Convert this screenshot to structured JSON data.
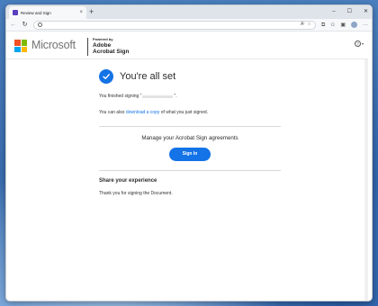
{
  "browser": {
    "tab_title": "Review and Sign",
    "new_tab_symbol": "+",
    "close_symbol": "×",
    "window_controls": [
      "–",
      "☐",
      "✕"
    ],
    "toolbar_symbols": {
      "back": "←",
      "refresh": "↻",
      "read_aloud": "A⁾",
      "favorite": "☆",
      "extensions": "⧉",
      "favorites_bar": "✩",
      "collections": "▣",
      "menu": "···"
    }
  },
  "header": {
    "brand": "Microsoft",
    "powered_by": "Powered by",
    "product_line1": "Adobe",
    "product_line2": "Acrobat Sign",
    "help_symbol": "?",
    "help_caret": "▾"
  },
  "content": {
    "success_title": "You're all set",
    "finished_prefix": "You finished signing \"",
    "finished_suffix": "\".",
    "download_prefix": "You can also ",
    "download_link": "download a copy",
    "download_suffix": " of what you just signed.",
    "manage_title": "Manage your Acrobat Sign agreements",
    "signin_label": "Sign In",
    "share_title": "Share your experience",
    "thanks_text": "Thank you for signing the Document."
  },
  "colors": {
    "accent": "#1473e6",
    "ms_red": "#f25022",
    "ms_green": "#7fba00",
    "ms_blue": "#00a4ef",
    "ms_yellow": "#ffb900"
  }
}
